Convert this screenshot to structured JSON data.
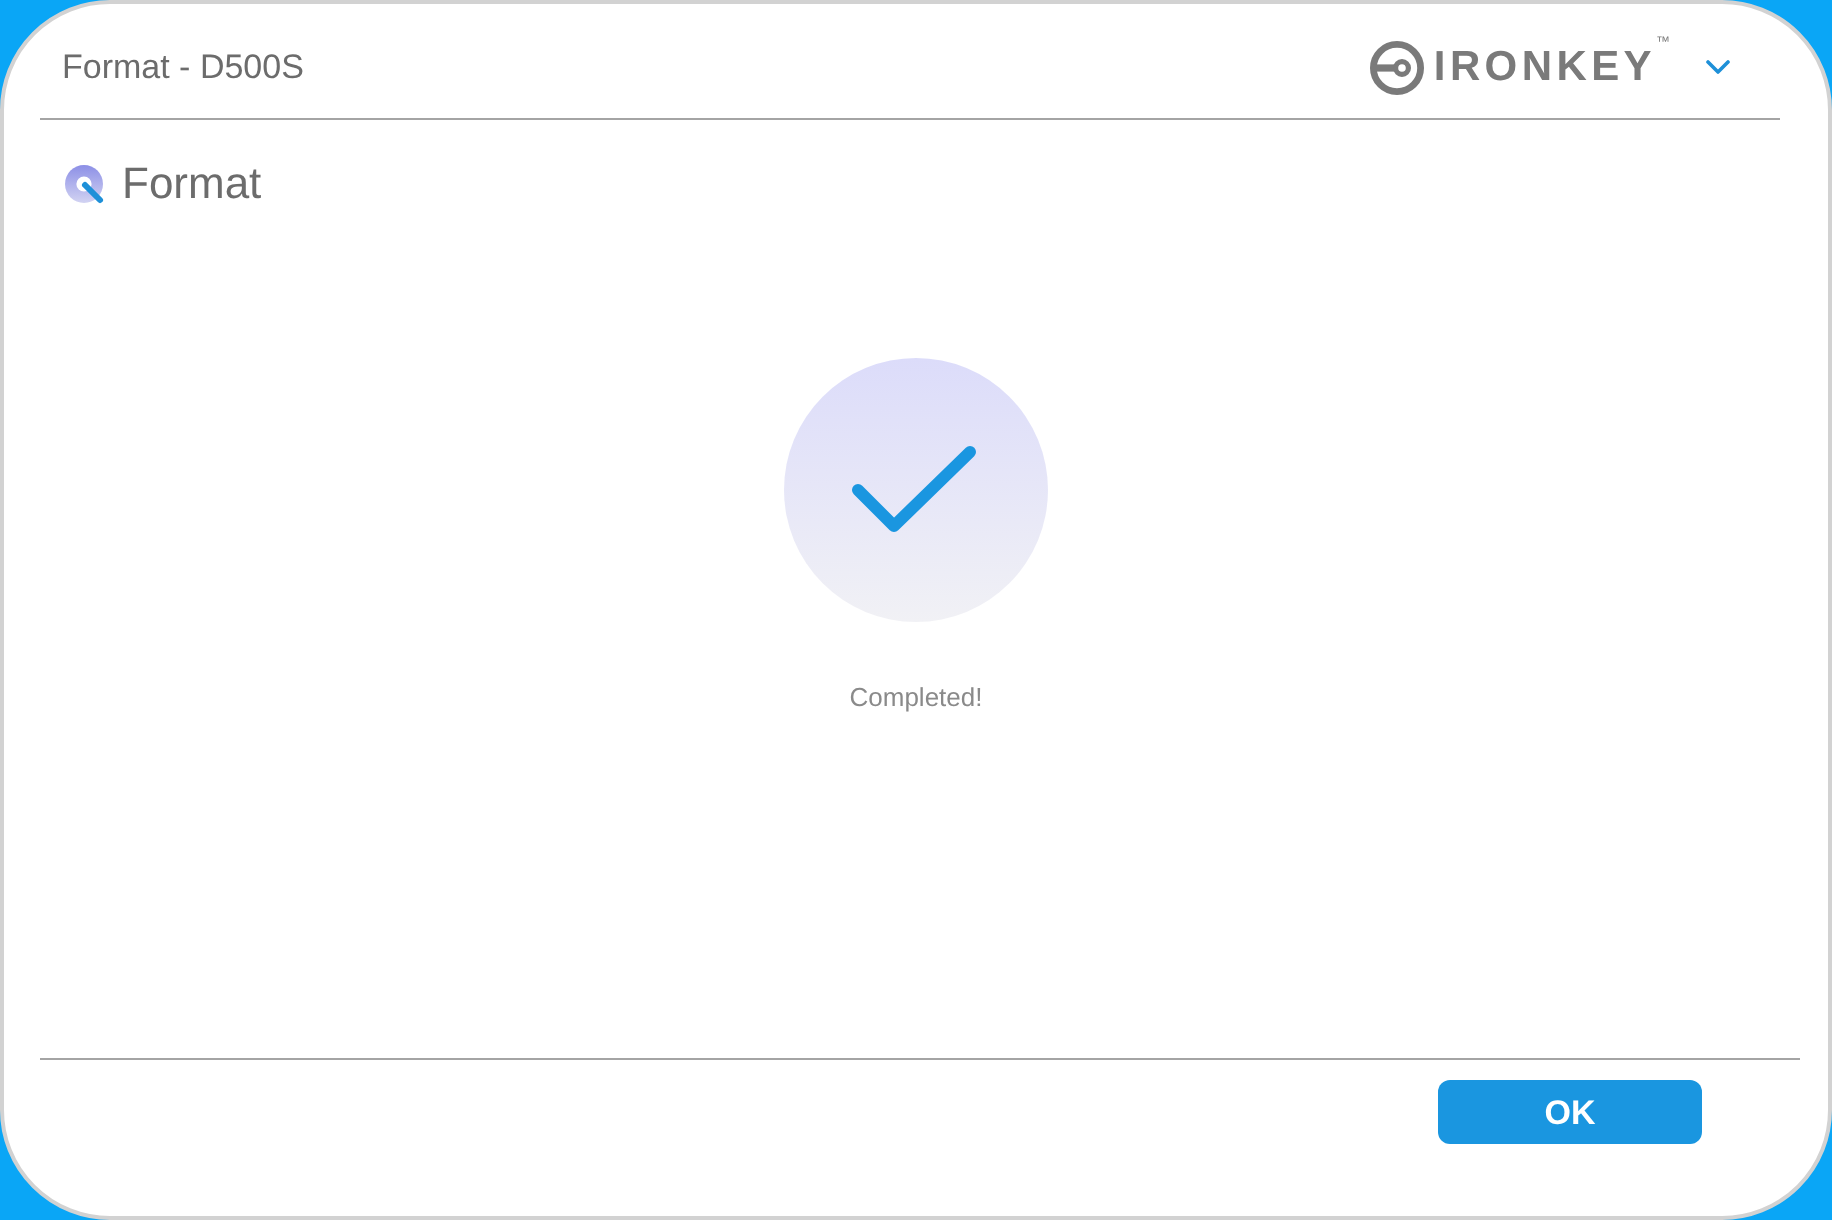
{
  "window": {
    "title": "Format - D500S"
  },
  "brand": {
    "name": "IRONKEY",
    "trademark": "™"
  },
  "page": {
    "heading": "Format"
  },
  "result": {
    "message": "Completed!"
  },
  "buttons": [
    {
      "label": "OK"
    }
  ]
}
